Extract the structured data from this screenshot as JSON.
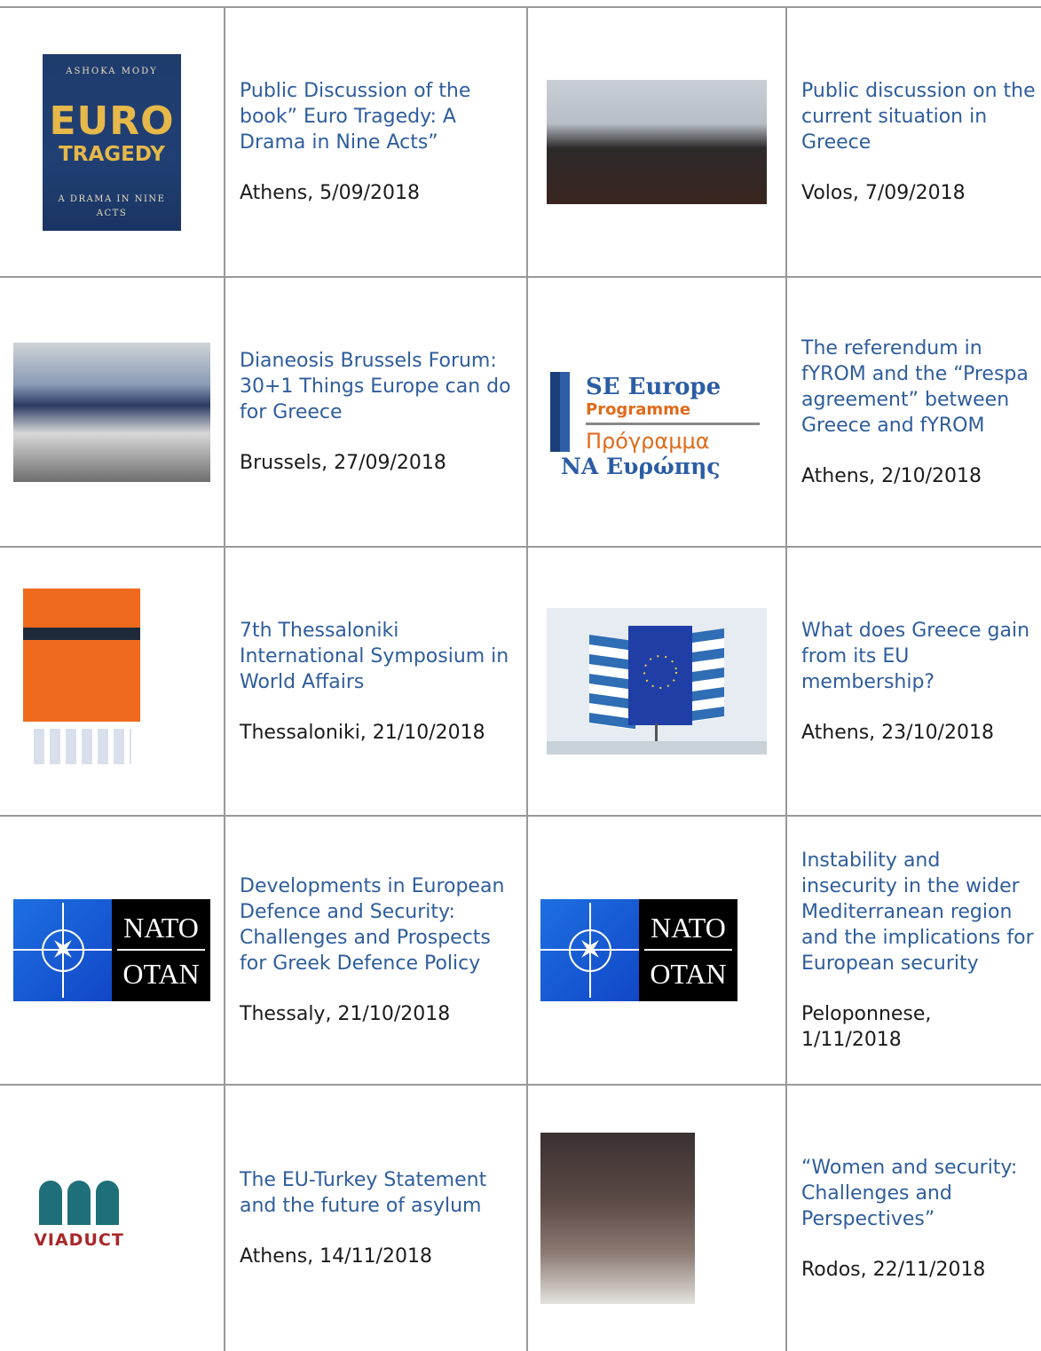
{
  "rows": [
    {
      "left": {
        "title": "Public Discussion of the book” Euro Tragedy: A Drama in Nine Acts”",
        "location": "Athens, 5/09/2018",
        "image": {
          "kind": "book-cover",
          "author": "ASHOKA MODY",
          "word1": "EURO",
          "word2": "TRAGEDY",
          "subtitle": "A DRAMA IN NINE ACTS"
        }
      },
      "right": {
        "title": "Public discussion on the current situation in Greece",
        "location": "Volos, 7/09/2018",
        "image": {
          "kind": "photo-panel-discussion"
        }
      }
    },
    {
      "left": {
        "title": "Dianeosis Brussels Forum: 30+1 Things Europe can do for Greece",
        "location": "Brussels, 27/09/2018",
        "image": {
          "kind": "photo-conference"
        }
      },
      "right": {
        "title": "The referendum in fYROM and the “Prespa agreement” between Greece and fYROM",
        "location": "Athens, 2/10/2018",
        "image": {
          "kind": "eliamep-logo",
          "line1": "SE Europe",
          "line2": "Programme",
          "line3": "Πρόγραμμα",
          "line4": "ΝΑ Ευρώπης"
        }
      }
    },
    {
      "left": {
        "title": "7th Thessaloniki International Symposium in World Affairs",
        "location": "Thessaloniki, 21/10/2018",
        "image": {
          "kind": "symposium-poster"
        }
      },
      "right": {
        "title": "What does Greece gain from its EU membership?",
        "location": "Athens, 23/10/2018",
        "image": {
          "kind": "flags-photo"
        }
      }
    },
    {
      "left": {
        "title": "Developments in European Defence and Security: Challenges and Prospects for Greek Defence Policy",
        "location": "Thessaly, 21/10/2018",
        "image": {
          "kind": "nato-logo",
          "t1": "NATO",
          "t2": "OTAN"
        }
      },
      "right": {
        "title": "Instability and insecurity in the wider Mediterranean region and the implications for European security",
        "location": "Peloponnese, 1/11/2018",
        "image": {
          "kind": "nato-logo",
          "t1": "NATO",
          "t2": "OTAN"
        }
      }
    },
    {
      "left": {
        "title": "The EU-Turkey Statement and the future of asylum",
        "location": "Athens, 14/11/2018",
        "image": {
          "kind": "viaduct-logo",
          "word": "VIADUCT"
        }
      },
      "right": {
        "title": "“Women and security: Challenges and Perspectives”",
        "location": "Rodos, 22/11/2018",
        "image": {
          "kind": "photo-classroom"
        }
      }
    }
  ]
}
